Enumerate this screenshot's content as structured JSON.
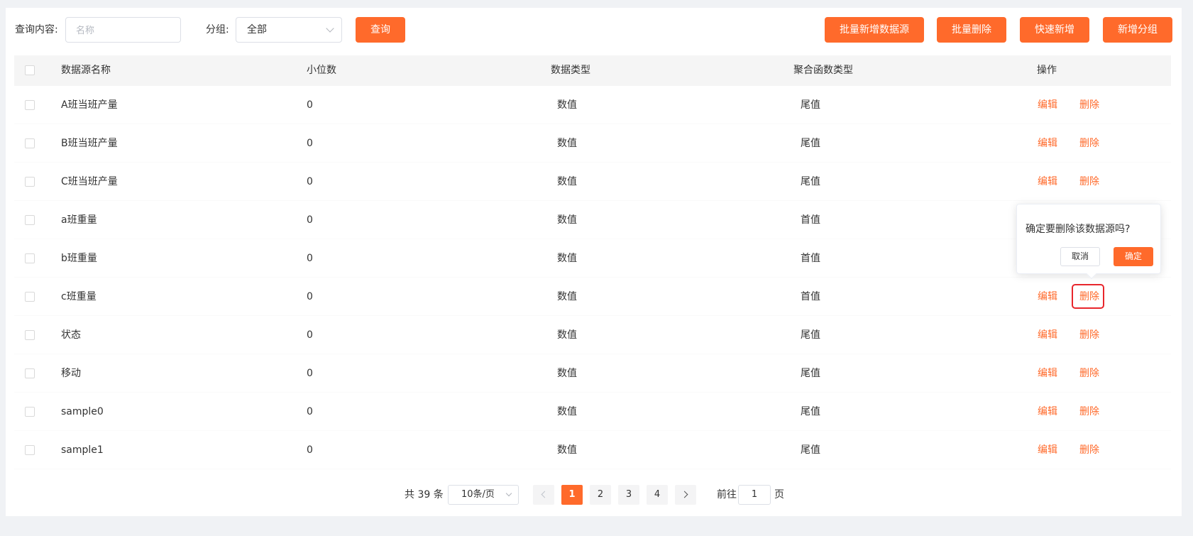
{
  "search": {
    "query_label": "查询内容:",
    "query_placeholder": "名称",
    "group_label": "分组:",
    "group_value": "全部",
    "query_button": "查询"
  },
  "toolbar": {
    "batch_add": "批量新增数据源",
    "batch_delete": "批量删除",
    "quick_add": "快速新增",
    "add_group": "新增分组"
  },
  "table": {
    "headers": [
      "数据源名称",
      "小位数",
      "数据类型",
      "聚合函数类型",
      "操作"
    ],
    "edit_label": "编辑",
    "delete_label": "删除",
    "rows": [
      {
        "name": "A班当班产量",
        "decimals": "0",
        "type": "数值",
        "agg": "尾值"
      },
      {
        "name": "B班当班产量",
        "decimals": "0",
        "type": "数值",
        "agg": "尾值"
      },
      {
        "name": "C班当班产量",
        "decimals": "0",
        "type": "数值",
        "agg": "尾值"
      },
      {
        "name": "a班重量",
        "decimals": "0",
        "type": "数值",
        "agg": "首值"
      },
      {
        "name": "b班重量",
        "decimals": "0",
        "type": "数值",
        "agg": "首值"
      },
      {
        "name": "c班重量",
        "decimals": "0",
        "type": "数值",
        "agg": "首值"
      },
      {
        "name": "状态",
        "decimals": "0",
        "type": "数值",
        "agg": "尾值"
      },
      {
        "name": "移动",
        "decimals": "0",
        "type": "数值",
        "agg": "尾值"
      },
      {
        "name": "sample0",
        "decimals": "0",
        "type": "数值",
        "agg": "尾值"
      },
      {
        "name": "sample1",
        "decimals": "0",
        "type": "数值",
        "agg": "尾值"
      }
    ]
  },
  "popconfirm": {
    "message": "确定要删除该数据源吗?",
    "cancel": "取消",
    "confirm": "确定"
  },
  "pagination": {
    "total_text": "共 39 条",
    "page_size": "10条/页",
    "pages": [
      "1",
      "2",
      "3",
      "4"
    ],
    "current": "1",
    "goto_prefix": "前往",
    "goto_value": "1",
    "goto_suffix": "页"
  },
  "colors": {
    "accent": "#ff6a2b",
    "highlight": "#e8262c"
  }
}
